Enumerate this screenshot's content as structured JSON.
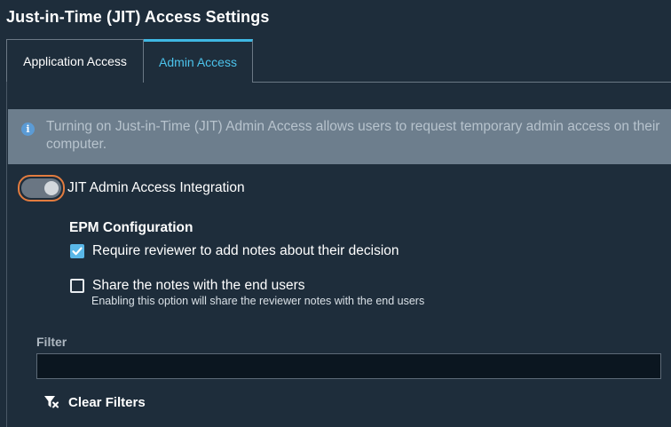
{
  "page": {
    "title": "Just-in-Time (JIT) Access Settings"
  },
  "tabs": [
    {
      "label": "Application Access",
      "active": false
    },
    {
      "label": "Admin Access",
      "active": true
    }
  ],
  "info_banner": {
    "icon": "info-icon",
    "text": "Turning on Just-in-Time (JIT) Admin Access allows users to request temporary admin access on their computer."
  },
  "integration_toggle": {
    "label": "JIT Admin Access Integration",
    "on": false
  },
  "epm_config": {
    "heading": "EPM Configuration",
    "require_notes": {
      "label": "Require reviewer to add notes about their decision",
      "checked": true
    },
    "share_notes": {
      "label": "Share the notes with the end users",
      "description": "Enabling this option will share the reviewer notes with the end users",
      "checked": false
    }
  },
  "filter": {
    "label": "Filter",
    "value": "",
    "clear_label": "Clear Filters",
    "clear_icon": "filter-clear-icon"
  },
  "colors": {
    "accent": "#3fb8e3",
    "focus_ring": "#e37c3f",
    "banner_bg": "#6d7e8d",
    "page_bg": "#1e2d3b"
  }
}
